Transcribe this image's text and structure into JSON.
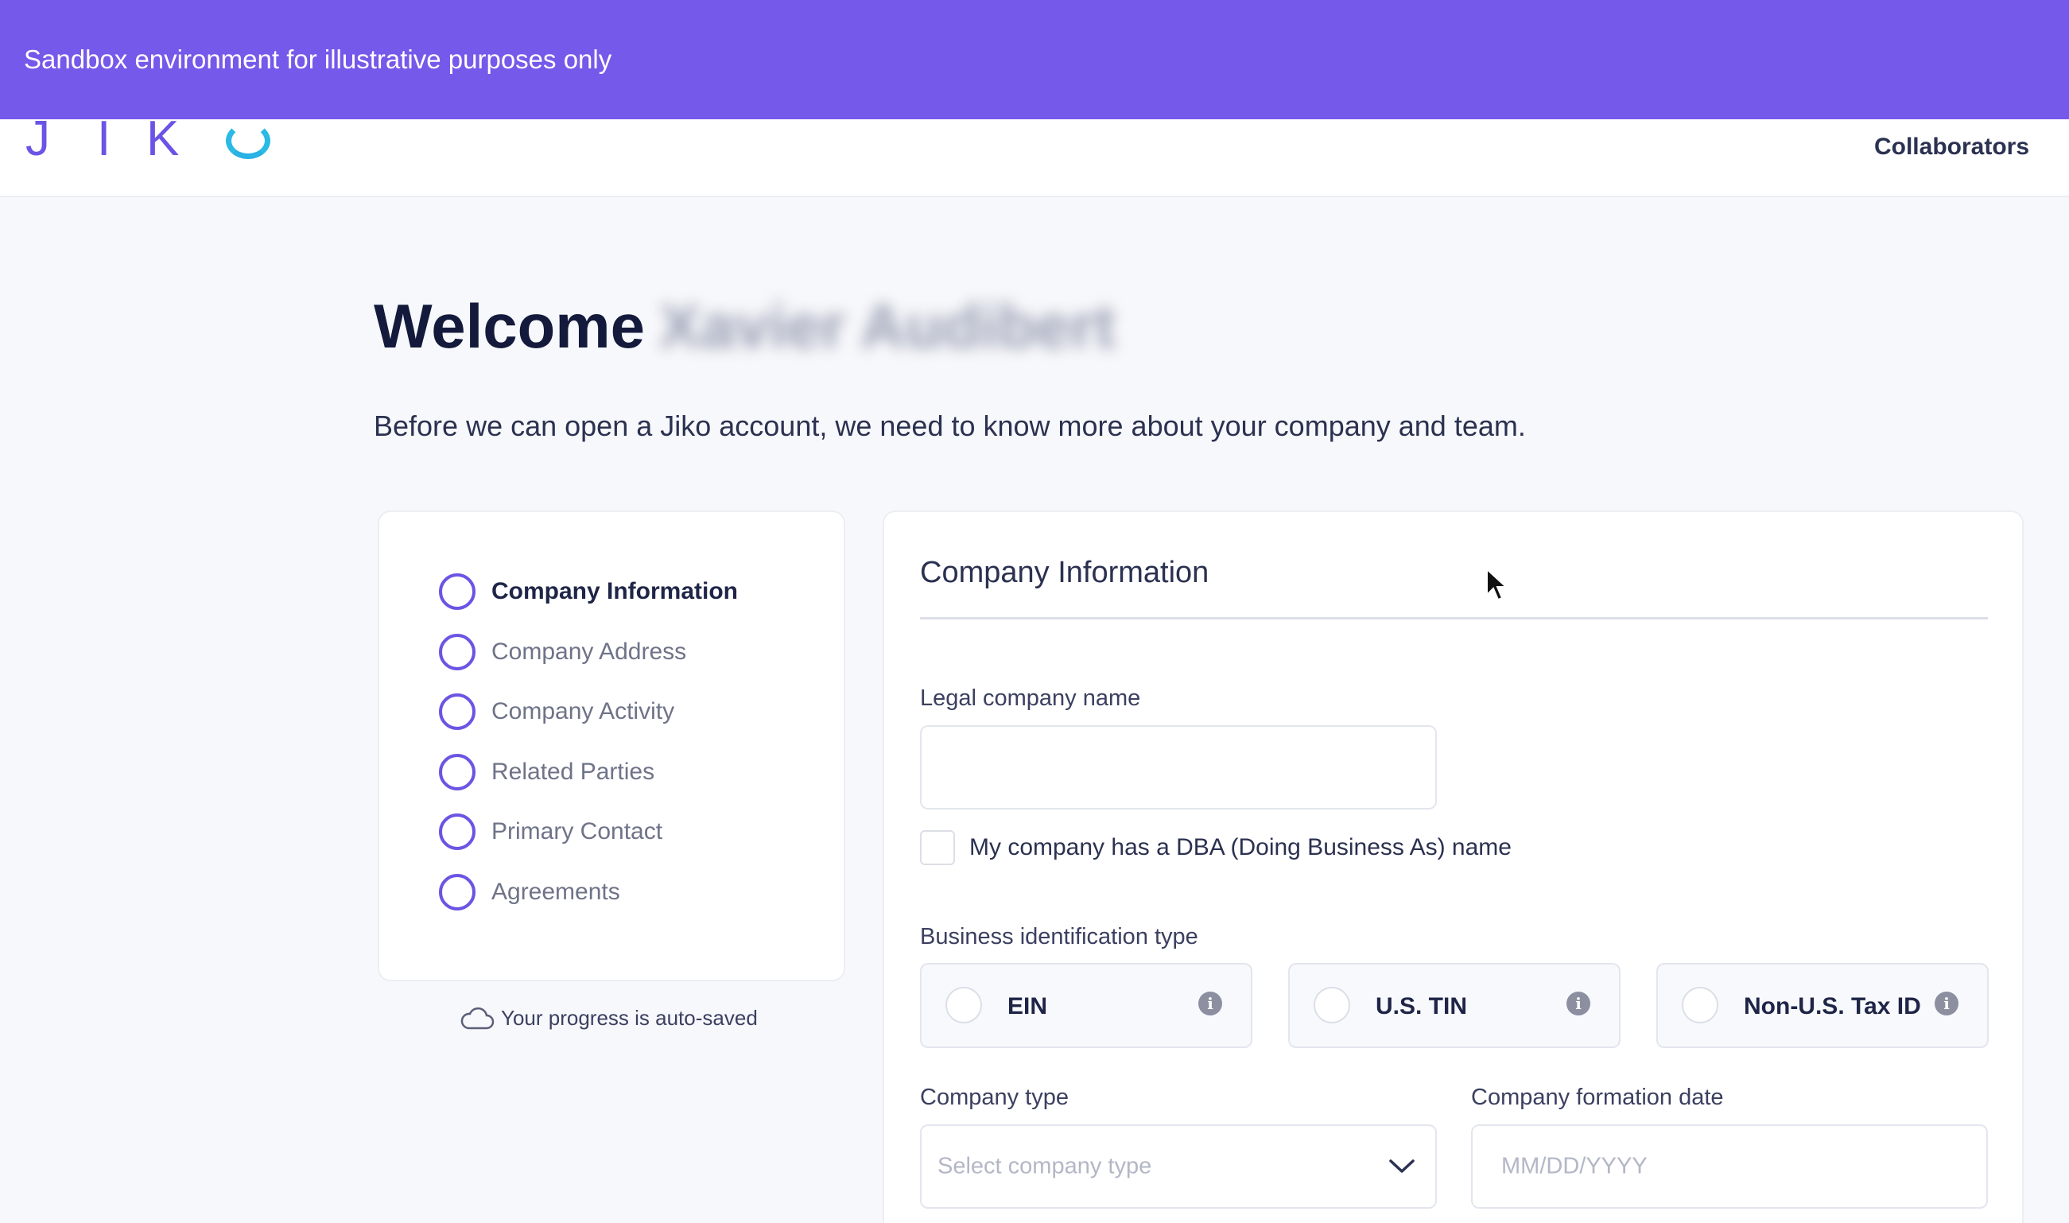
{
  "banner": {
    "text": "Sandbox environment for illustrative purposes only"
  },
  "header": {
    "logo_letters": [
      "J",
      "I",
      "K"
    ],
    "collaborators_label": "Collaborators"
  },
  "welcome": {
    "greeting": "Welcome",
    "user_name_redacted": "Xavier Audibert",
    "intro": "Before we can open a Jiko account, we need to know more about your company and team."
  },
  "steps": [
    {
      "label": "Company Information"
    },
    {
      "label": "Company Address"
    },
    {
      "label": "Company Activity"
    },
    {
      "label": "Related Parties"
    },
    {
      "label": "Primary Contact"
    },
    {
      "label": "Agreements"
    }
  ],
  "autosave": {
    "text": "Your progress is auto-saved"
  },
  "form": {
    "title": "Company Information",
    "legal_name": {
      "label": "Legal company name",
      "value": ""
    },
    "dba_checkbox_label": "My company has a DBA (Doing Business As) name",
    "business_id": {
      "label": "Business identification type",
      "options": [
        "EIN",
        "U.S. TIN",
        "Non-U.S. Tax ID"
      ]
    },
    "company_type": {
      "label": "Company type",
      "placeholder": "Select company type"
    },
    "formation_date": {
      "label": "Company formation date",
      "placeholder": "MM/DD/YYYY"
    }
  },
  "colors": {
    "brand_purple": "#7459ea",
    "step_circle": "#6c54e4",
    "logo_blue": "#2bb9e6"
  },
  "icons": [
    "cloud-icon",
    "info-icon",
    "chevron-down-icon",
    "mouse-cursor"
  ]
}
